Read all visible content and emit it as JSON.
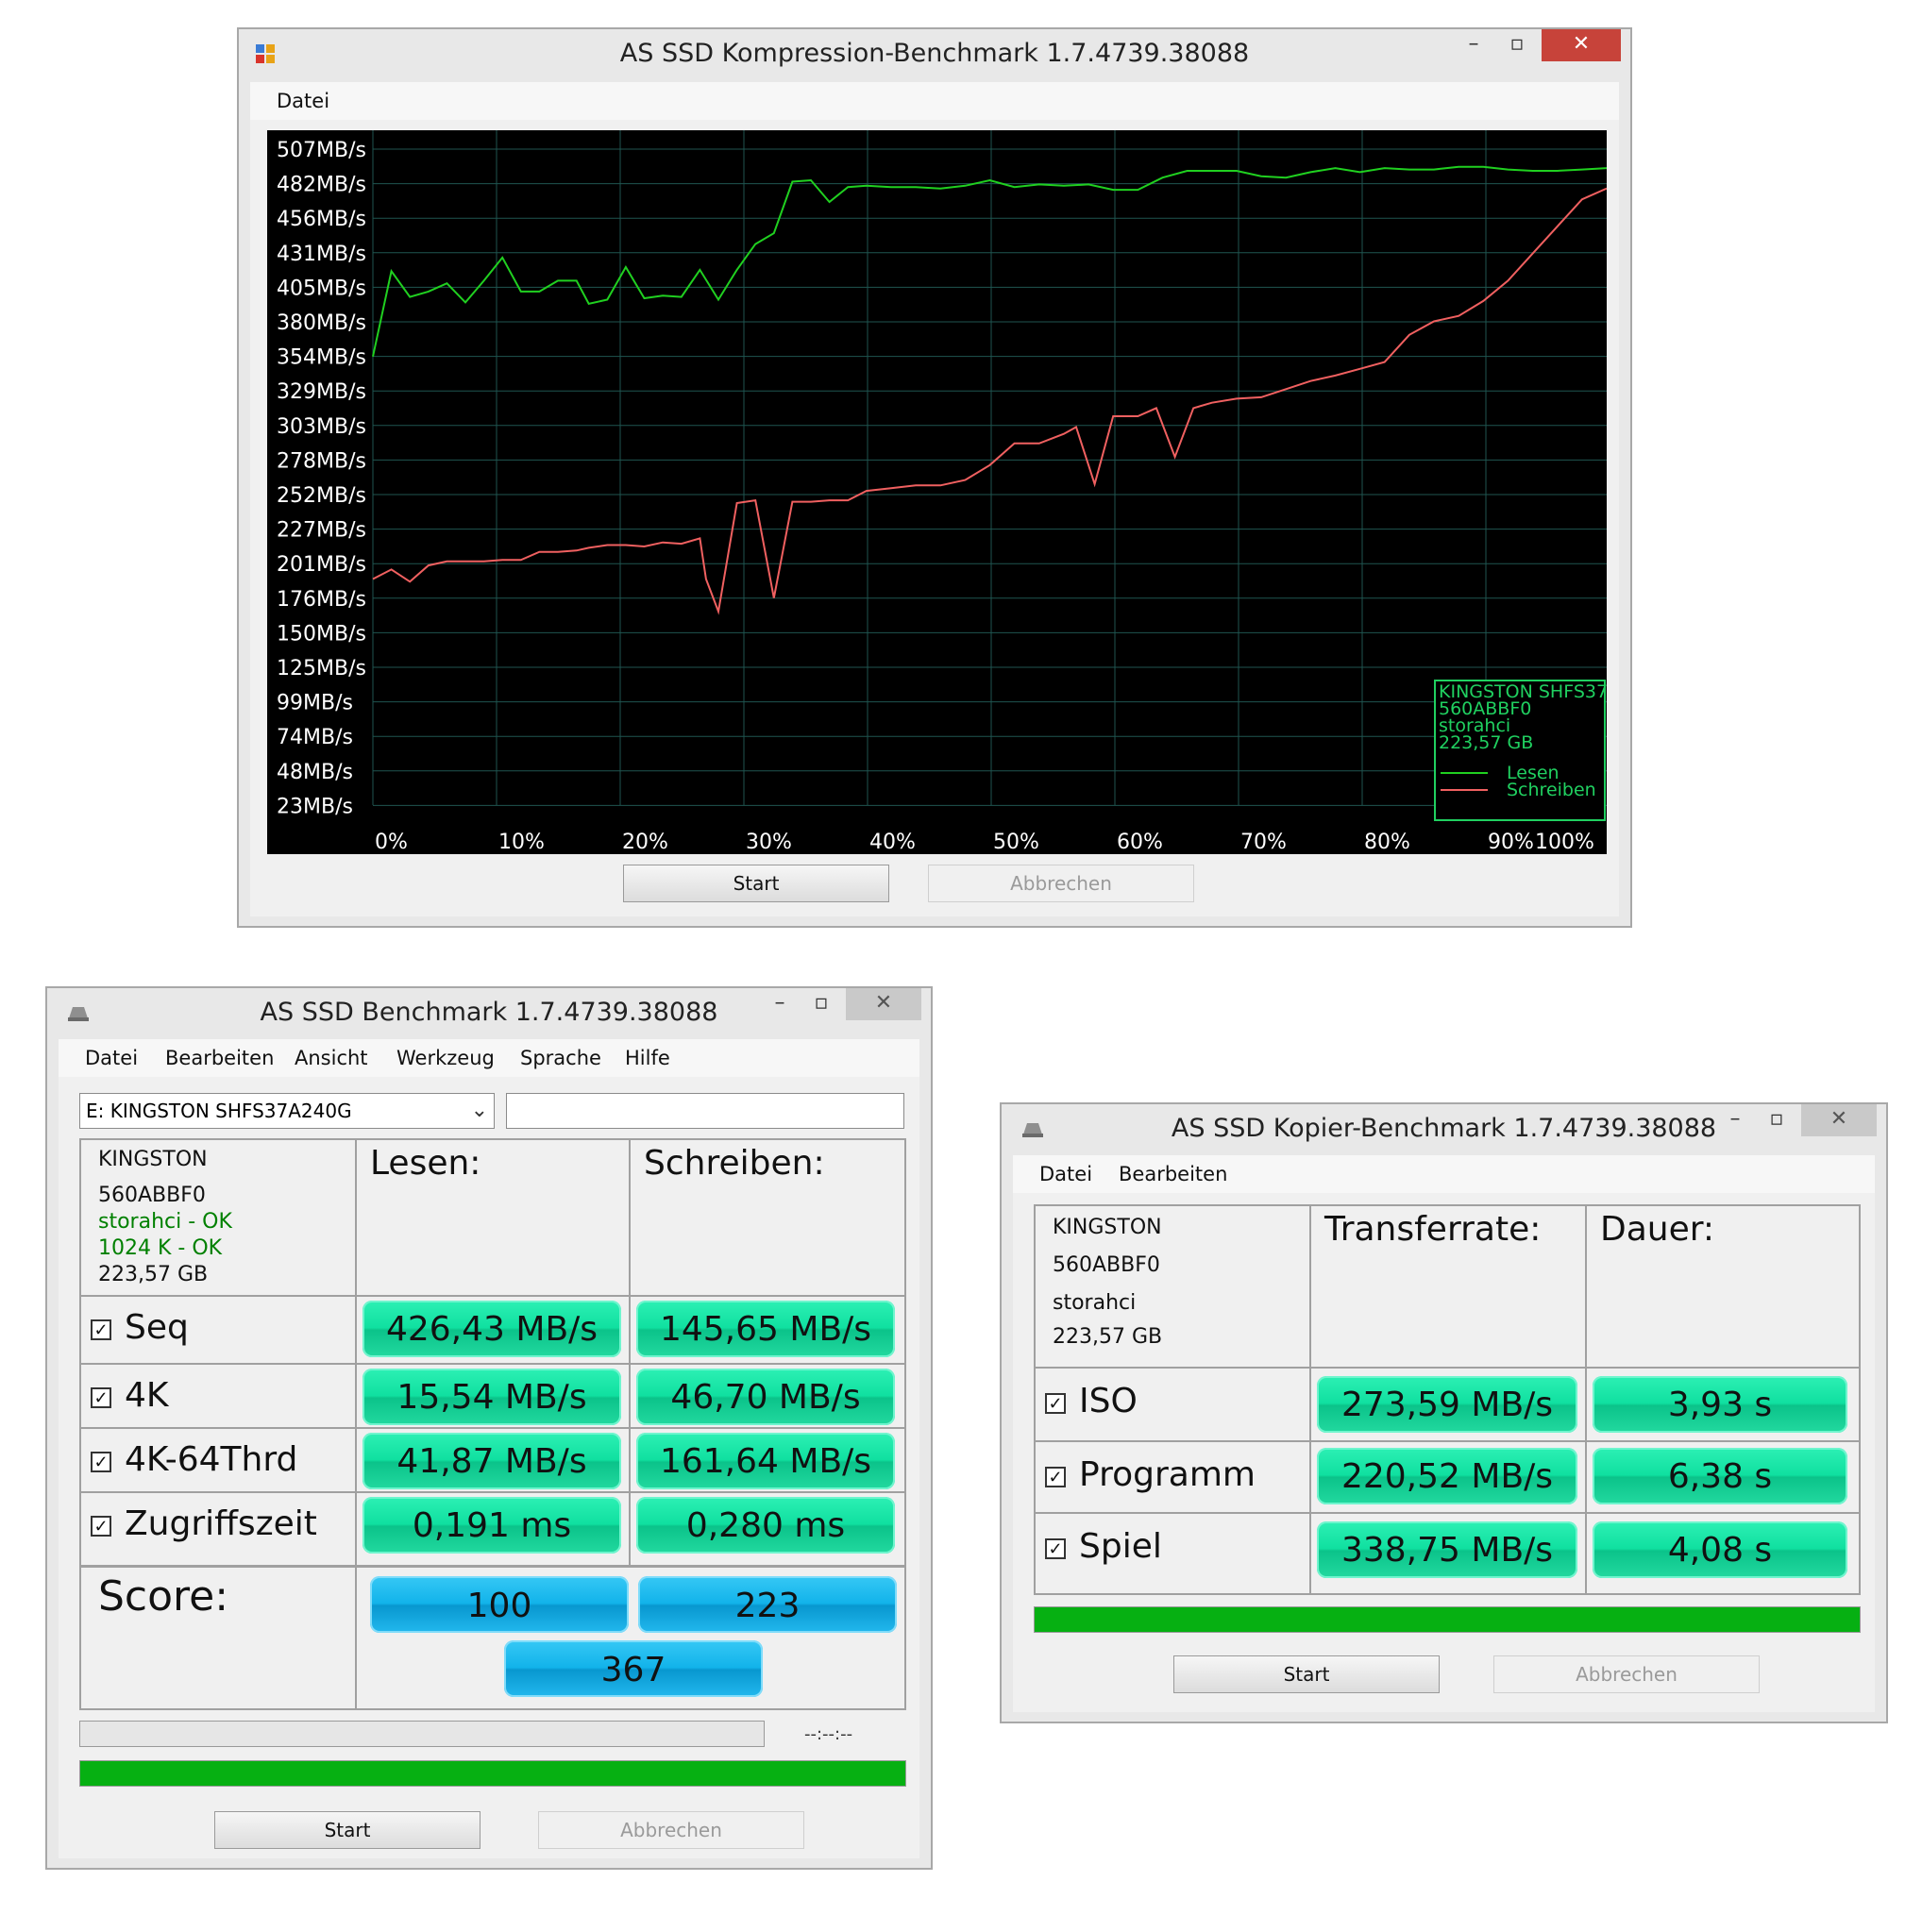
{
  "compression_window": {
    "title": "AS SSD Kompression-Benchmark 1.7.4739.38088",
    "menu": [
      "Datei"
    ],
    "start_label": "Start",
    "cancel_label": "Abbrechen",
    "legend": {
      "drive": "KINGSTON SHFS37",
      "firmware": "560ABBF0",
      "driver": "storahci",
      "size": "223,57 GB",
      "read_label": "Lesen",
      "write_label": "Schreiben"
    },
    "colors": {
      "read": "#20d020",
      "write": "#f06060",
      "grid": "#1f5550",
      "legend_border": "#20d060"
    }
  },
  "chart_data": {
    "type": "line",
    "y_ticks": [
      "507MB/s",
      "482MB/s",
      "456MB/s",
      "431MB/s",
      "405MB/s",
      "380MB/s",
      "354MB/s",
      "329MB/s",
      "303MB/s",
      "278MB/s",
      "252MB/s",
      "227MB/s",
      "201MB/s",
      "176MB/s",
      "150MB/s",
      "125MB/s",
      "99MB/s",
      "74MB/s",
      "48MB/s",
      "23MB/s"
    ],
    "x_ticks": [
      "0%",
      "10%",
      "20%",
      "30%",
      "40%",
      "50%",
      "60%",
      "70%",
      "80%",
      "90%",
      "100%"
    ],
    "ylim": [
      23,
      507
    ],
    "xlim": [
      0,
      100
    ],
    "grid": true,
    "legend_position": "bottom-right",
    "series": [
      {
        "name": "Lesen",
        "x": [
          0,
          1.5,
          3,
          4.5,
          6,
          7.5,
          9,
          10.5,
          12,
          13.5,
          15,
          16.5,
          17.5,
          19,
          20.5,
          22,
          23.5,
          25,
          26.5,
          28,
          29.5,
          31,
          32.5,
          34,
          35.5,
          37,
          38.5,
          40,
          42,
          44,
          46,
          48,
          50,
          52,
          54,
          56,
          58,
          60,
          62,
          64,
          66,
          68,
          70,
          72,
          74,
          76,
          78,
          80,
          82,
          84,
          86,
          88,
          90,
          92,
          94,
          96,
          98,
          100
        ],
        "y": [
          354,
          417,
          398,
          402,
          408,
          394,
          410,
          427,
          402,
          402,
          410,
          410,
          393,
          396,
          420,
          397,
          399,
          398,
          418,
          396,
          418,
          437,
          445,
          483,
          484,
          468,
          479,
          480,
          479,
          479,
          478,
          480,
          484,
          479,
          481,
          480,
          481,
          477,
          477,
          486,
          491,
          491,
          491,
          487,
          486,
          490,
          493,
          490,
          493,
          492,
          492,
          494,
          494,
          492,
          491,
          491,
          492,
          493
        ]
      },
      {
        "name": "Schreiben",
        "x": [
          0,
          1.5,
          3,
          4.5,
          6,
          7.5,
          9,
          10.5,
          12,
          13.5,
          15,
          16.5,
          17.5,
          19,
          20.5,
          22,
          23.5,
          25,
          26.5,
          27,
          28,
          29.5,
          31,
          32.5,
          34,
          35.5,
          37,
          38.5,
          40,
          42,
          44,
          46,
          48,
          50,
          52,
          54,
          56,
          57,
          58.5,
          60,
          62,
          63.5,
          65,
          66.5,
          68,
          70,
          72,
          74,
          76,
          78,
          80,
          82,
          84,
          86,
          88,
          90,
          92,
          94,
          96,
          98,
          100
        ],
        "y": [
          190,
          197,
          188,
          200,
          203,
          203,
          203,
          204,
          204,
          210,
          210,
          211,
          213,
          215,
          215,
          214,
          217,
          216,
          220,
          190,
          166,
          246,
          248,
          176,
          247,
          247,
          248,
          248,
          255,
          257,
          259,
          259,
          263,
          274,
          290,
          290,
          297,
          302,
          260,
          310,
          310,
          316,
          280,
          316,
          320,
          323,
          324,
          330,
          336,
          340,
          345,
          350,
          370,
          380,
          384,
          395,
          410,
          430,
          450,
          470,
          478
        ]
      }
    ]
  },
  "benchmark_window": {
    "title": "AS SSD Benchmark 1.7.4739.38088",
    "menu": [
      "Datei",
      "Bearbeiten",
      "Ansicht",
      "Werkzeug",
      "Sprache",
      "Hilfe"
    ],
    "drive_select": "E: KINGSTON SHFS37A240G",
    "text_field": "",
    "info": {
      "model": "KINGSTON",
      "firmware": "560ABBF0",
      "driver": "storahci - OK",
      "align": "1024 K - OK",
      "size": "223,57 GB"
    },
    "col_read": "Lesen:",
    "col_write": "Schreiben:",
    "rows": [
      {
        "label": "Seq",
        "read": "426,43 MB/s",
        "write": "145,65 MB/s"
      },
      {
        "label": "4K",
        "read": "15,54 MB/s",
        "write": "46,70 MB/s"
      },
      {
        "label": "4K-64Thrd",
        "read": "41,87 MB/s",
        "write": "161,64 MB/s"
      },
      {
        "label": "Zugriffszeit",
        "read": "0,191 ms",
        "write": "0,280 ms"
      }
    ],
    "score_label": "Score:",
    "score_read": "100",
    "score_write": "223",
    "score_total": "367",
    "time_label": "--:--:--",
    "progress": 1.0,
    "start_label": "Start",
    "cancel_label": "Abbrechen",
    "colors": {
      "ok": "#008000",
      "value_bar": "#10e0a0",
      "score_bar": "#12b3ea",
      "progress": "#06b012"
    }
  },
  "copy_window": {
    "title": "AS SSD Kopier-Benchmark 1.7.4739.38088",
    "menu": [
      "Datei",
      "Bearbeiten"
    ],
    "info": {
      "model": "KINGSTON",
      "firmware": "560ABBF0",
      "driver": "storahci",
      "size": "223,57 GB"
    },
    "col_rate": "Transferrate:",
    "col_time": "Dauer:",
    "rows": [
      {
        "label": "ISO",
        "rate": "273,59 MB/s",
        "time": "3,93 s"
      },
      {
        "label": "Programm",
        "rate": "220,52 MB/s",
        "time": "6,38 s"
      },
      {
        "label": "Spiel",
        "rate": "338,75 MB/s",
        "time": "4,08 s"
      }
    ],
    "progress": 1.0,
    "start_label": "Start",
    "cancel_label": "Abbrechen"
  }
}
